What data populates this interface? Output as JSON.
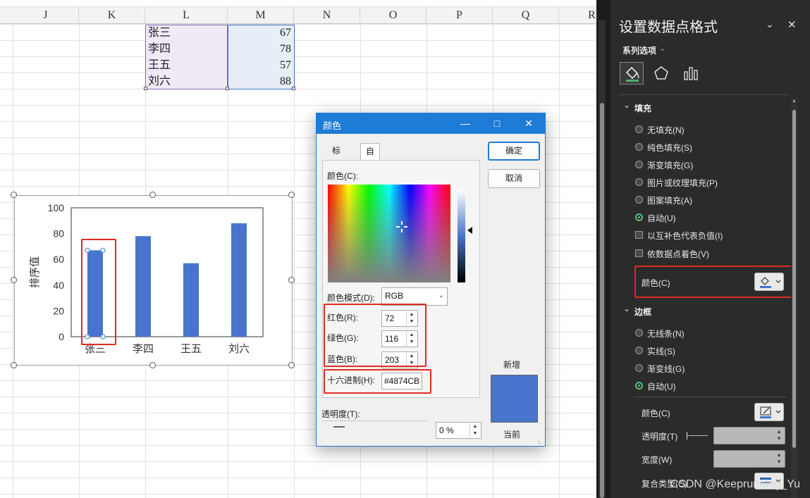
{
  "sheet": {
    "columns": [
      "J",
      "K",
      "L",
      "M",
      "N",
      "O",
      "P",
      "Q",
      "R"
    ],
    "rows": [
      {
        "name": "张三",
        "score": "67"
      },
      {
        "name": "李四",
        "score": "78"
      },
      {
        "name": "王五",
        "score": "57"
      },
      {
        "name": "刘六",
        "score": "88"
      }
    ]
  },
  "chart_data": {
    "type": "bar",
    "categories": [
      "张三",
      "李四",
      "王五",
      "刘六"
    ],
    "values": [
      67,
      78,
      57,
      88
    ],
    "title": "",
    "xlabel": "",
    "ylabel": "排序值",
    "ylim": [
      0,
      100
    ],
    "yticks": [
      "0",
      "20",
      "40",
      "60",
      "80",
      "100"
    ],
    "bar_color": "#4874CB",
    "selected_point": "张三",
    "grid": false,
    "legend": "none"
  },
  "dialog": {
    "title": "颜色",
    "tabs": [
      "标准",
      "自定义"
    ],
    "active_tab": "自定义",
    "color_label": "颜色(C):",
    "model_label": "颜色模式(D):",
    "model_value": "RGB",
    "red_label": "红色(R):",
    "red_value": "72",
    "green_label": "绿色(G):",
    "green_value": "116",
    "blue_label": "蓝色(B):",
    "blue_value": "203",
    "hex_label": "十六进制(H):",
    "hex_value": "#4874CB",
    "transparency_label": "透明度(T):",
    "transparency_value": "0 %",
    "ok_label": "确定",
    "cancel_label": "取消",
    "new_label": "新增",
    "current_label": "当前",
    "swatch_color": "#4874CB"
  },
  "pane": {
    "title": "设置数据点格式",
    "series_options": "系列选项",
    "fill_section": "填充",
    "fill_options": [
      {
        "label": "无填充(N)",
        "kind": "radio",
        "checked": false
      },
      {
        "label": "纯色填充(S)",
        "kind": "radio",
        "checked": false
      },
      {
        "label": "渐变填充(G)",
        "kind": "radio",
        "checked": false
      },
      {
        "label": "图片或纹理填充(P)",
        "kind": "radio",
        "checked": false
      },
      {
        "label": "图案填充(A)",
        "kind": "radio",
        "checked": false
      },
      {
        "label": "自动(U)",
        "kind": "radio",
        "checked": true
      },
      {
        "label": "以互补色代表负值(I)",
        "kind": "checkbox",
        "checked": false
      },
      {
        "label": "依数据点着色(V)",
        "kind": "checkbox",
        "checked": false
      }
    ],
    "fill_color_label": "颜色(C)",
    "border_section": "边框",
    "border_options": [
      {
        "label": "无线条(N)",
        "checked": false
      },
      {
        "label": "实线(S)",
        "checked": false
      },
      {
        "label": "渐变线(G)",
        "checked": false
      },
      {
        "label": "自动(U)",
        "checked": true
      }
    ],
    "border_color_label": "颜色(C)",
    "transparency_label": "透明度(T)",
    "width_label": "宽度(W)",
    "compound_label": "复合类型(C)",
    "watermark": "CSDN @Keeprunning_Yu"
  }
}
